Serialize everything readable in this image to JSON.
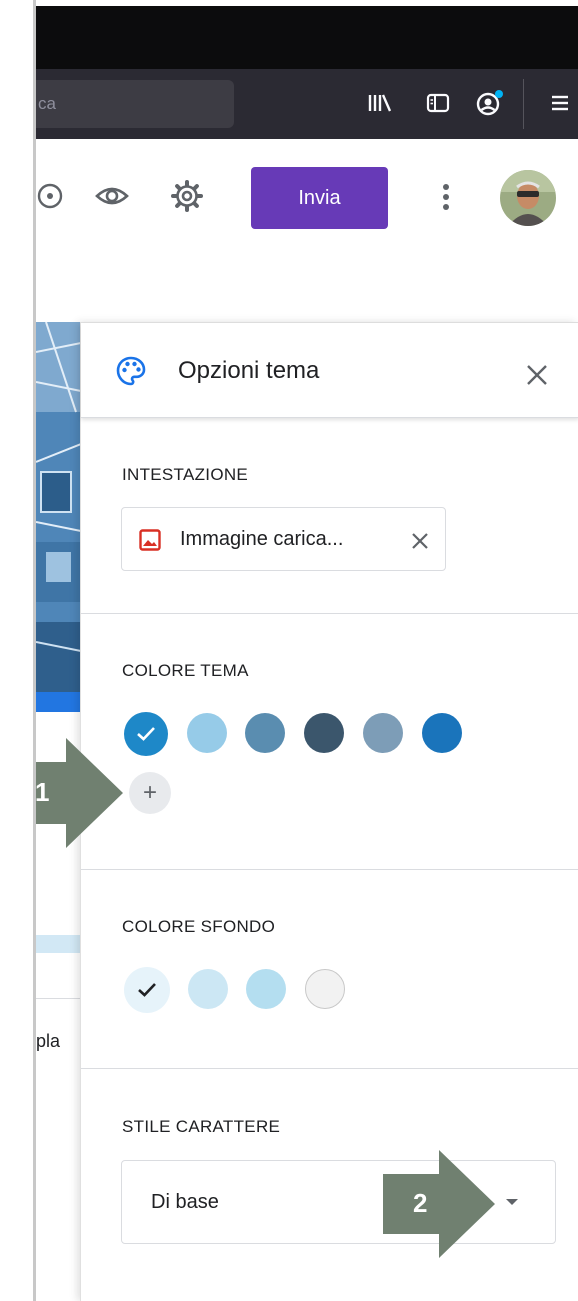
{
  "browser": {
    "url_text": "ca",
    "icons": [
      "library-icon",
      "sidebar-icon",
      "account-icon",
      "menu-icon"
    ]
  },
  "header": {
    "send_label": "Invia",
    "icons": [
      "palette-icon",
      "eye-icon",
      "gear-icon",
      "more-vert-icon"
    ]
  },
  "background_form": {
    "partial_text": "pla"
  },
  "panel": {
    "title": "Opzioni tema",
    "header_section": {
      "label": "INTESTAZIONE",
      "chip_text": "Immagine carica..."
    },
    "theme_color": {
      "label": "COLORE TEMA",
      "colors": [
        "#1e88c8",
        "#96cbe8",
        "#5a8db0",
        "#3b566c",
        "#7d9db7",
        "#1a74bb"
      ],
      "selected_index": 0,
      "add_symbol": "+"
    },
    "background_color": {
      "label": "COLORE SFONDO",
      "colors": [
        "#e6f3fa",
        "#cce7f4",
        "#b4def0",
        "#f2f2f2"
      ],
      "selected_index": 0
    },
    "font_style": {
      "label": "STILE CARATTERE",
      "value": "Di base"
    }
  },
  "annotations": {
    "callout_1": "1",
    "callout_2": "2",
    "color": "#708070"
  }
}
